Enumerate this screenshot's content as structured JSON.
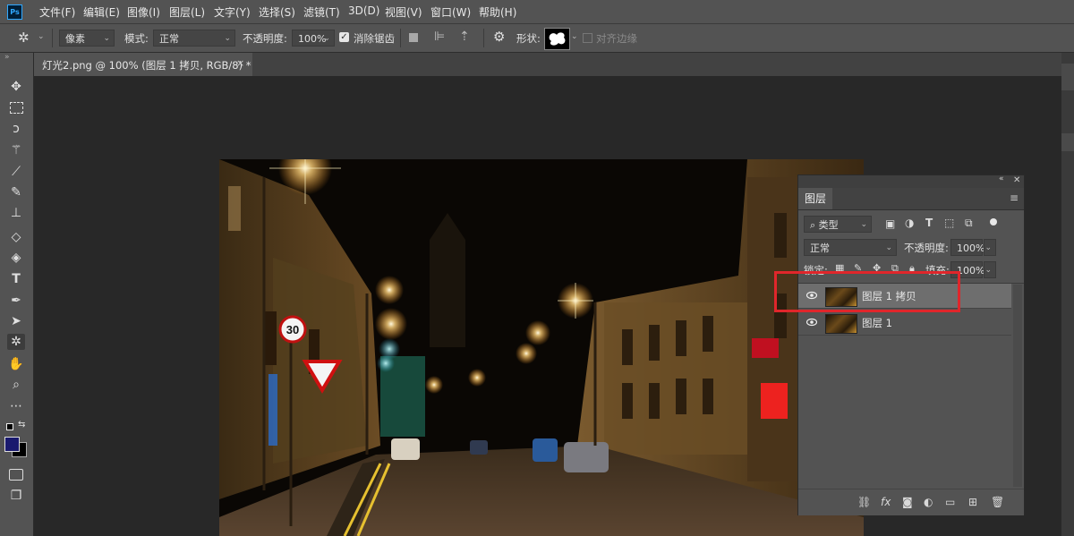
{
  "app": {
    "logo": "Ps"
  },
  "menu": [
    "文件(F)",
    "编辑(E)",
    "图像(I)",
    "图层(L)",
    "文字(Y)",
    "选择(S)",
    "滤镜(T)",
    "3D(D)",
    "视图(V)",
    "窗口(W)",
    "帮助(H)"
  ],
  "options": {
    "fill_mode": "像素",
    "mode_label": "模式:",
    "mode_value": "正常",
    "opacity_label": "不透明度:",
    "opacity_value": "100%",
    "antialias_label": "消除锯齿",
    "antialias_checked": true,
    "shape_label": "形状:",
    "align_edges_label": "对齐边缘"
  },
  "document_tab": {
    "title": "灯光2.png @ 100% (图层 1 拷贝, RGB/8) *",
    "close": "×"
  },
  "tools": [
    "move-icon",
    "marquee-icon",
    "lasso-icon",
    "magic-wand-icon",
    "eyedropper-icon",
    "brush-icon",
    "stamp-icon",
    "eraser-icon",
    "paint-bucket-icon",
    "type-icon",
    "pen-icon",
    "path-select-icon",
    "shape-icon",
    "hand-icon",
    "zoom-icon",
    "more-icon"
  ],
  "colors": {
    "foreground": "#1a1a6e",
    "background": "#000000",
    "highlight": "#e0262b",
    "accent": "#31a8ff"
  },
  "layers_panel": {
    "tab": "图层",
    "filter_label": "类型",
    "blend_mode": "正常",
    "opacity_label": "不透明度:",
    "opacity_value": "100%",
    "lock_label": "锁定:",
    "fill_label": "填充:",
    "fill_value": "100%",
    "layers": [
      {
        "name": "图层 1 拷贝",
        "selected": true,
        "visible": true
      },
      {
        "name": "图层 1",
        "selected": false,
        "visible": true
      }
    ]
  }
}
